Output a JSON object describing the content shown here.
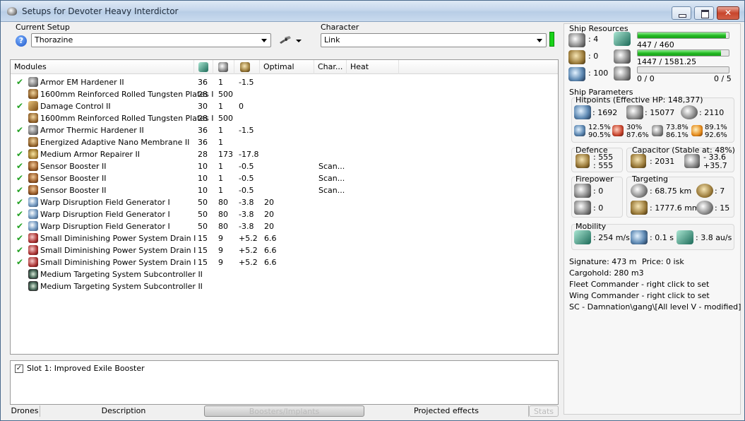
{
  "window": {
    "title": "Setups for Devoter Heavy Interdictor"
  },
  "setup": {
    "label": "Current Setup",
    "value": "Thorazine"
  },
  "character": {
    "label": "Character",
    "value": "Link",
    "status_color": "#1ad31a"
  },
  "modules": {
    "headers": {
      "name": "Modules",
      "optimal": "Optimal",
      "charge": "Char...",
      "heat": "Heat"
    },
    "header_icons": [
      "cpu-icon",
      "powergrid-icon",
      "capacitor-icon"
    ],
    "rows": [
      {
        "active": true,
        "icon": "armor-hardener-icon",
        "name": "Armor EM Hardener II",
        "cpu": "36",
        "pg": "1",
        "cap": "-1.5",
        "optimal": "",
        "charge": ""
      },
      {
        "active": false,
        "icon": "armor-plate-icon",
        "name": "1600mm Reinforced Rolled Tungsten Plates I",
        "cpu": "28",
        "pg": "500",
        "cap": "",
        "optimal": "",
        "charge": ""
      },
      {
        "active": true,
        "icon": "damage-control-icon",
        "name": "Damage Control II",
        "cpu": "30",
        "pg": "1",
        "cap": "0",
        "optimal": "",
        "charge": ""
      },
      {
        "active": false,
        "icon": "armor-plate-icon",
        "name": "1600mm Reinforced Rolled Tungsten Plates I",
        "cpu": "28",
        "pg": "500",
        "cap": "",
        "optimal": "",
        "charge": ""
      },
      {
        "active": true,
        "icon": "armor-hardener-icon",
        "name": "Armor Thermic Hardener II",
        "cpu": "36",
        "pg": "1",
        "cap": "-1.5",
        "optimal": "",
        "charge": ""
      },
      {
        "active": false,
        "icon": "nano-membrane-icon",
        "name": "Energized Adaptive Nano Membrane II",
        "cpu": "36",
        "pg": "1",
        "cap": "",
        "optimal": "",
        "charge": ""
      },
      {
        "active": true,
        "icon": "armor-repairer-icon",
        "name": "Medium Armor Repairer II",
        "cpu": "28",
        "pg": "173",
        "cap": "-17.8",
        "optimal": "",
        "charge": ""
      },
      {
        "active": true,
        "icon": "sensor-booster-icon",
        "name": "Sensor Booster II",
        "cpu": "10",
        "pg": "1",
        "cap": "-0.5",
        "optimal": "",
        "charge": "Scan..."
      },
      {
        "active": true,
        "icon": "sensor-booster-icon",
        "name": "Sensor Booster II",
        "cpu": "10",
        "pg": "1",
        "cap": "-0.5",
        "optimal": "",
        "charge": "Scan..."
      },
      {
        "active": true,
        "icon": "sensor-booster-icon",
        "name": "Sensor Booster II",
        "cpu": "10",
        "pg": "1",
        "cap": "-0.5",
        "optimal": "",
        "charge": "Scan..."
      },
      {
        "active": true,
        "icon": "warp-disruption-icon",
        "name": "Warp Disruption Field Generator I",
        "cpu": "50",
        "pg": "80",
        "cap": "-3.8",
        "optimal": "20",
        "charge": ""
      },
      {
        "active": true,
        "icon": "warp-disruption-icon",
        "name": "Warp Disruption Field Generator I",
        "cpu": "50",
        "pg": "80",
        "cap": "-3.8",
        "optimal": "20",
        "charge": ""
      },
      {
        "active": true,
        "icon": "warp-disruption-icon",
        "name": "Warp Disruption Field Generator I",
        "cpu": "50",
        "pg": "80",
        "cap": "-3.8",
        "optimal": "20",
        "charge": ""
      },
      {
        "active": true,
        "icon": "power-drain-icon",
        "name": "Small Diminishing Power System Drain I",
        "cpu": "15",
        "pg": "9",
        "cap": "+5.2",
        "optimal": "6.6",
        "charge": ""
      },
      {
        "active": true,
        "icon": "power-drain-icon",
        "name": "Small Diminishing Power System Drain I",
        "cpu": "15",
        "pg": "9",
        "cap": "+5.2",
        "optimal": "6.6",
        "charge": ""
      },
      {
        "active": true,
        "icon": "power-drain-icon",
        "name": "Small Diminishing Power System Drain I",
        "cpu": "15",
        "pg": "9",
        "cap": "+5.2",
        "optimal": "6.6",
        "charge": ""
      },
      {
        "active": false,
        "icon": "targeting-subcontroller-icon",
        "name": "Medium Targeting System Subcontroller II",
        "cpu": "",
        "pg": "",
        "cap": "",
        "optimal": "",
        "charge": ""
      },
      {
        "active": false,
        "icon": "targeting-subcontroller-icon",
        "name": "Medium Targeting System Subcontroller II",
        "cpu": "",
        "pg": "",
        "cap": "",
        "optimal": "",
        "charge": ""
      }
    ]
  },
  "boosters": {
    "items": [
      {
        "checked": true,
        "label": "Slot 1: Improved Exile Booster"
      }
    ]
  },
  "tabs": [
    "Drones",
    "Description",
    "Boosters/Implants",
    "Projected effects",
    "Stats"
  ],
  "resources": {
    "title": "Ship Resources",
    "turret": ": 4",
    "launcher": ": 0",
    "drone_bay": ": 100",
    "cpu": {
      "text": "447 / 460",
      "fraction": 0.972
    },
    "powergrid": {
      "text": "1447 / 1581.25",
      "fraction": 0.915
    },
    "drones_a": "0 / 0",
    "drones_b": "0 / 5",
    "drones_fraction": 0
  },
  "params": {
    "title": "Ship Parameters",
    "hitpoints_title": "Hitpoints (Effective HP: 148,377)",
    "shield_hp": ": 1692",
    "armor_hp": ": 15077",
    "structure_hp": ": 2110",
    "res": {
      "em": [
        "12.5%",
        "90.5%"
      ],
      "thermal": [
        "30%",
        "87.6%"
      ],
      "kinetic": [
        "73.8%",
        "86.1%"
      ],
      "explosive": [
        "89.1%",
        "92.6%"
      ]
    },
    "defence_title": "Defence",
    "defence_a": ": 555",
    "defence_b": ": 555",
    "capacitor_title": "Capacitor (Stable at: 48%)",
    "capacitor_val": ": 2031",
    "capacitor_drain": "- 33.6",
    "capacitor_gain": "+35.7",
    "firepower_title": "Firepower",
    "firepower_a": ": 0",
    "firepower_b": ": 0",
    "targeting_title": "Targeting",
    "target_range": ": 68.75 km",
    "max_targets": ": 7",
    "scan_res": ": 1777.6 mm",
    "sensor_str": ": 15",
    "mobility_title": "Mobility",
    "speed": ": 254 m/s",
    "align": ": 0.1 s",
    "warp": ": 3.8 au/s"
  },
  "info": {
    "signature": "Signature: 473 m",
    "price": "Price: 0 isk",
    "cargo": "Cargohold: 280 m3",
    "fleet": "Fleet Commander - right click to set",
    "wing": "Wing Commander - right click to set",
    "squad": "SC - Damnation\\gang\\[All level V - modified]"
  },
  "colors": {
    "check": "#24a224",
    "bar_fill": "#22b822"
  }
}
